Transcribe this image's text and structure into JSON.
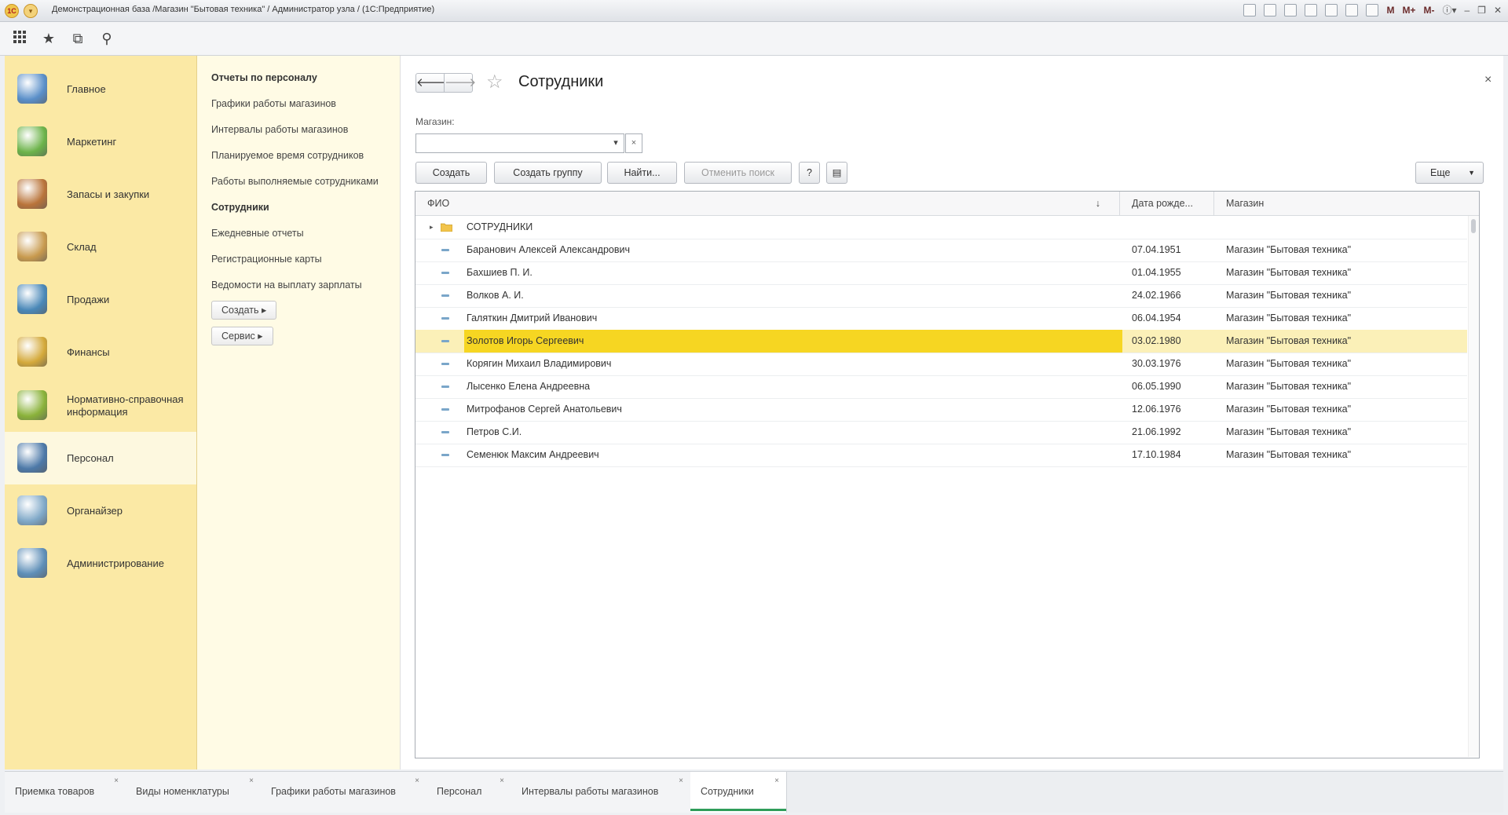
{
  "window": {
    "title": "Демонстрационная база /Магазин \"Бытовая техника\" / Администратор узла /  (1С:Предприятие)",
    "logo_text": "1С",
    "title_icons": [
      "M",
      "M+",
      "M-"
    ]
  },
  "toolbar": {
    "icons": [
      "apps-grid-icon",
      "star-icon",
      "history-icon",
      "search-icon"
    ]
  },
  "sidebar": {
    "items": [
      {
        "label": "Главное",
        "icon": "main-icon",
        "color": "#5a8fc9"
      },
      {
        "label": "Маркетинг",
        "icon": "marketing-pie-icon",
        "color": "#6cb34a"
      },
      {
        "label": "Запасы и закупки",
        "icon": "stock-boxes-icon",
        "color": "#b9743a"
      },
      {
        "label": "Склад",
        "icon": "warehouse-shelf-icon",
        "color": "#c89a4e"
      },
      {
        "label": "Продажи",
        "icon": "cash-register-icon",
        "color": "#4a88b8"
      },
      {
        "label": "Финансы",
        "icon": "coins-icon",
        "color": "#d4a93a"
      },
      {
        "label": "Нормативно-справочная информация",
        "icon": "binders-icon",
        "color": "#8ab23a"
      },
      {
        "label": "Персонал",
        "icon": "person-icon",
        "color": "#4d79a8"
      },
      {
        "label": "Органайзер",
        "icon": "clipboard-icon",
        "color": "#7fa8c8"
      },
      {
        "label": "Администрирование",
        "icon": "computer-icon",
        "color": "#5f8fb8"
      }
    ],
    "active_index": 7
  },
  "subsection": {
    "header": "Отчеты по персоналу",
    "links": [
      "Графики работы магазинов",
      "Интервалы работы магазинов",
      "Планируемое время сотрудников",
      "Работы выполняемые сотрудниками",
      "Сотрудники",
      "Ежедневные отчеты",
      "Регистрационные карты",
      "Ведомости на выплату зарплаты"
    ],
    "create_button": "Создать ▸",
    "service_button": "Сервис ▸"
  },
  "form": {
    "title": "Сотрудники",
    "back": "🡐",
    "forward": "🡒",
    "close": "×",
    "filter_label": "Магазин:",
    "filter_value": "",
    "filter_dropdown": "▾",
    "filter_clear": "×",
    "buttons": {
      "create": "Создать",
      "create_group": "Создать группу",
      "find": "Найти...",
      "cancel_search": "Отменить поиск",
      "help": "?",
      "more": "Еще"
    }
  },
  "table": {
    "columns": [
      "ФИО",
      "Дата рожде...",
      "Магазин"
    ],
    "sort_indicator": "↓",
    "group_row": "СОТРУДНИКИ",
    "rows": [
      {
        "fio": "Баранович Алексей Александрович",
        "date": "07.04.1951",
        "store": "Магазин \"Бытовая техника\""
      },
      {
        "fio": "Бахшиев П. И.",
        "date": "01.04.1955",
        "store": "Магазин \"Бытовая техника\""
      },
      {
        "fio": "Волков А. И.",
        "date": "24.02.1966",
        "store": "Магазин \"Бытовая техника\""
      },
      {
        "fio": "Галяткин Дмитрий Иванович",
        "date": "06.04.1954",
        "store": "Магазин \"Бытовая техника\""
      },
      {
        "fio": "Золотов Игорь Сергеевич",
        "date": "03.02.1980",
        "store": "Магазин \"Бытовая техника\""
      },
      {
        "fio": "Корягин Михаил Владимирович",
        "date": "30.03.1976",
        "store": "Магазин \"Бытовая техника\""
      },
      {
        "fio": "Лысенко Елена Андреевна",
        "date": "06.05.1990",
        "store": "Магазин \"Бытовая техника\""
      },
      {
        "fio": "Митрофанов Сергей Анатольевич",
        "date": "12.06.1976",
        "store": "Магазин \"Бытовая техника\""
      },
      {
        "fio": "Петров С.И.",
        "date": "21.06.1992",
        "store": "Магазин \"Бытовая техника\""
      },
      {
        "fio": "Семенюк Максим Андреевич",
        "date": "17.10.1984",
        "store": "Магазин \"Бытовая техника\""
      }
    ],
    "selected_index": 4
  },
  "tabs": [
    {
      "label": "Приемка товаров"
    },
    {
      "label": "Виды номенклатуры"
    },
    {
      "label": "Графики работы магазинов"
    },
    {
      "label": "Персонал"
    },
    {
      "label": "Интервалы работы магазинов"
    },
    {
      "label": "Сотрудники"
    }
  ],
  "active_tab": 5,
  "colors": {
    "sidebar_bg": "#fbe9a5",
    "selection": "#f6d622",
    "active_tab_underline": "#2f9d5a"
  }
}
